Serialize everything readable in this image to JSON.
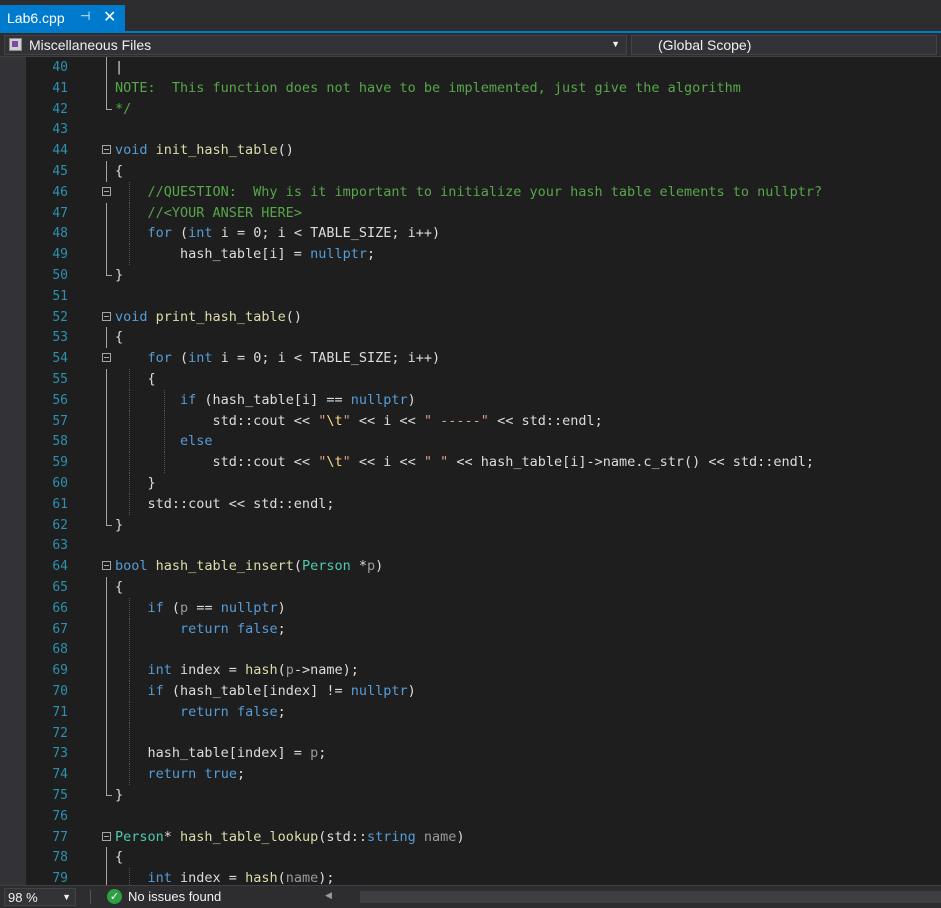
{
  "tab": {
    "title": "Lab6.cpp",
    "pin": "⊣",
    "close": "✕"
  },
  "nav": {
    "project": "Miscellaneous Files",
    "scope": "(Global Scope)"
  },
  "status": {
    "zoom": "98 %",
    "issues": "No issues found"
  },
  "colors": {
    "accent": "#007acc",
    "keyword": "#569cd6",
    "comment": "#57a64a",
    "string": "#d69d85",
    "type": "#4ec9b0",
    "function": "#dcdcaa",
    "line_number": "#2b91af"
  },
  "lines": [
    {
      "n": "40",
      "t": [
        [
          "",
          "|"
        ]
      ]
    },
    {
      "n": "41",
      "t": [
        [
          "cm",
          "NOTE:  This function does not have to be implemented, just give the algorithm"
        ]
      ]
    },
    {
      "n": "42",
      "t": [
        [
          "cm",
          "*/"
        ]
      ]
    },
    {
      "n": "43",
      "t": []
    },
    {
      "n": "44",
      "t": [
        [
          "kw",
          "void"
        ],
        [
          "",
          " "
        ],
        [
          "fn",
          "init_hash_table"
        ],
        [
          "",
          "()"
        ]
      ]
    },
    {
      "n": "45",
      "t": [
        [
          "",
          "{"
        ]
      ]
    },
    {
      "n": "46",
      "t": [
        [
          "",
          "    "
        ],
        [
          "cm",
          "//QUESTION:  Why is it important to initialize your hash table elements to nullptr?"
        ]
      ]
    },
    {
      "n": "47",
      "t": [
        [
          "",
          "    "
        ],
        [
          "cm",
          "//<YOUR ANSER HERE>"
        ]
      ]
    },
    {
      "n": "48",
      "t": [
        [
          "",
          "    "
        ],
        [
          "kw",
          "for"
        ],
        [
          "",
          " ("
        ],
        [
          "kw",
          "int"
        ],
        [
          "",
          " i = 0; i < TABLE_SIZE; i++)"
        ]
      ]
    },
    {
      "n": "49",
      "t": [
        [
          "",
          "        hash_table[i] = "
        ],
        [
          "kw",
          "nullptr"
        ],
        [
          "",
          ";"
        ]
      ]
    },
    {
      "n": "50",
      "t": [
        [
          "",
          "}"
        ]
      ]
    },
    {
      "n": "51",
      "t": []
    },
    {
      "n": "52",
      "t": [
        [
          "kw",
          "void"
        ],
        [
          "",
          " "
        ],
        [
          "fn",
          "print_hash_table"
        ],
        [
          "",
          "()"
        ]
      ]
    },
    {
      "n": "53",
      "t": [
        [
          "",
          "{"
        ]
      ]
    },
    {
      "n": "54",
      "t": [
        [
          "",
          "    "
        ],
        [
          "kw",
          "for"
        ],
        [
          "",
          " ("
        ],
        [
          "kw",
          "int"
        ],
        [
          "",
          " i = 0; i < TABLE_SIZE; i++)"
        ]
      ]
    },
    {
      "n": "55",
      "t": [
        [
          "",
          "    {"
        ]
      ]
    },
    {
      "n": "56",
      "t": [
        [
          "",
          "        "
        ],
        [
          "kw",
          "if"
        ],
        [
          "",
          " (hash_table[i] == "
        ],
        [
          "kw",
          "nullptr"
        ],
        [
          "",
          ")"
        ]
      ]
    },
    {
      "n": "57",
      "t": [
        [
          "",
          "            std::cout << "
        ],
        [
          "st",
          "\""
        ],
        [
          "es",
          "\\t"
        ],
        [
          "st",
          "\""
        ],
        [
          "",
          " << i << "
        ],
        [
          "st",
          "\" -----\""
        ],
        [
          "",
          " << std::endl;"
        ]
      ]
    },
    {
      "n": "58",
      "t": [
        [
          "",
          "        "
        ],
        [
          "kw",
          "else"
        ]
      ]
    },
    {
      "n": "59",
      "t": [
        [
          "",
          "            std::cout << "
        ],
        [
          "st",
          "\""
        ],
        [
          "es",
          "\\t"
        ],
        [
          "st",
          "\""
        ],
        [
          "",
          " << i << "
        ],
        [
          "st",
          "\" \""
        ],
        [
          "",
          " << hash_table[i]->name.c_str() << std::endl;"
        ]
      ]
    },
    {
      "n": "60",
      "t": [
        [
          "",
          "    }"
        ]
      ]
    },
    {
      "n": "61",
      "t": [
        [
          "",
          "    std::cout << std::endl;"
        ]
      ]
    },
    {
      "n": "62",
      "t": [
        [
          "",
          "}"
        ]
      ]
    },
    {
      "n": "63",
      "t": []
    },
    {
      "n": "64",
      "t": [
        [
          "kw",
          "bool"
        ],
        [
          "",
          " "
        ],
        [
          "fn",
          "hash_table_insert"
        ],
        [
          "",
          "("
        ],
        [
          "ty",
          "Person"
        ],
        [
          "",
          " *"
        ],
        [
          "pa",
          "p"
        ],
        [
          "",
          ")"
        ]
      ]
    },
    {
      "n": "65",
      "t": [
        [
          "",
          "{"
        ]
      ]
    },
    {
      "n": "66",
      "t": [
        [
          "",
          "    "
        ],
        [
          "kw",
          "if"
        ],
        [
          "",
          " ("
        ],
        [
          "pa",
          "p"
        ],
        [
          "",
          " == "
        ],
        [
          "kw",
          "nullptr"
        ],
        [
          "",
          ")"
        ]
      ]
    },
    {
      "n": "67",
      "t": [
        [
          "",
          "        "
        ],
        [
          "kw",
          "return"
        ],
        [
          "",
          " "
        ],
        [
          "kw",
          "false"
        ],
        [
          "",
          ";"
        ]
      ]
    },
    {
      "n": "68",
      "t": []
    },
    {
      "n": "69",
      "t": [
        [
          "",
          "    "
        ],
        [
          "kw",
          "int"
        ],
        [
          "",
          " index = "
        ],
        [
          "fn",
          "hash"
        ],
        [
          "",
          "("
        ],
        [
          "pa",
          "p"
        ],
        [
          "",
          "->name);"
        ]
      ]
    },
    {
      "n": "70",
      "t": [
        [
          "",
          "    "
        ],
        [
          "kw",
          "if"
        ],
        [
          "",
          " (hash_table[index] != "
        ],
        [
          "kw",
          "nullptr"
        ],
        [
          "",
          ")"
        ]
      ]
    },
    {
      "n": "71",
      "t": [
        [
          "",
          "        "
        ],
        [
          "kw",
          "return"
        ],
        [
          "",
          " "
        ],
        [
          "kw",
          "false"
        ],
        [
          "",
          ";"
        ]
      ]
    },
    {
      "n": "72",
      "t": []
    },
    {
      "n": "73",
      "t": [
        [
          "",
          "    hash_table[index] = "
        ],
        [
          "pa",
          "p"
        ],
        [
          "",
          ";"
        ]
      ]
    },
    {
      "n": "74",
      "t": [
        [
          "",
          "    "
        ],
        [
          "kw",
          "return"
        ],
        [
          "",
          " "
        ],
        [
          "kw",
          "true"
        ],
        [
          "",
          ";"
        ]
      ]
    },
    {
      "n": "75",
      "t": [
        [
          "",
          "}"
        ]
      ]
    },
    {
      "n": "76",
      "t": []
    },
    {
      "n": "77",
      "t": [
        [
          "ty",
          "Person"
        ],
        [
          "",
          "* "
        ],
        [
          "fn",
          "hash_table_lookup"
        ],
        [
          "",
          "(std::"
        ],
        [
          "kw",
          "string"
        ],
        [
          "",
          " "
        ],
        [
          "pa",
          "name"
        ],
        [
          "",
          ")"
        ]
      ]
    },
    {
      "n": "78",
      "t": [
        [
          "",
          "{"
        ]
      ]
    },
    {
      "n": "79",
      "t": [
        [
          "",
          "    "
        ],
        [
          "kw",
          "int"
        ],
        [
          "",
          " index = "
        ],
        [
          "fn",
          "hash"
        ],
        [
          "",
          "("
        ],
        [
          "pa",
          "name"
        ],
        [
          "",
          ");"
        ]
      ]
    }
  ]
}
